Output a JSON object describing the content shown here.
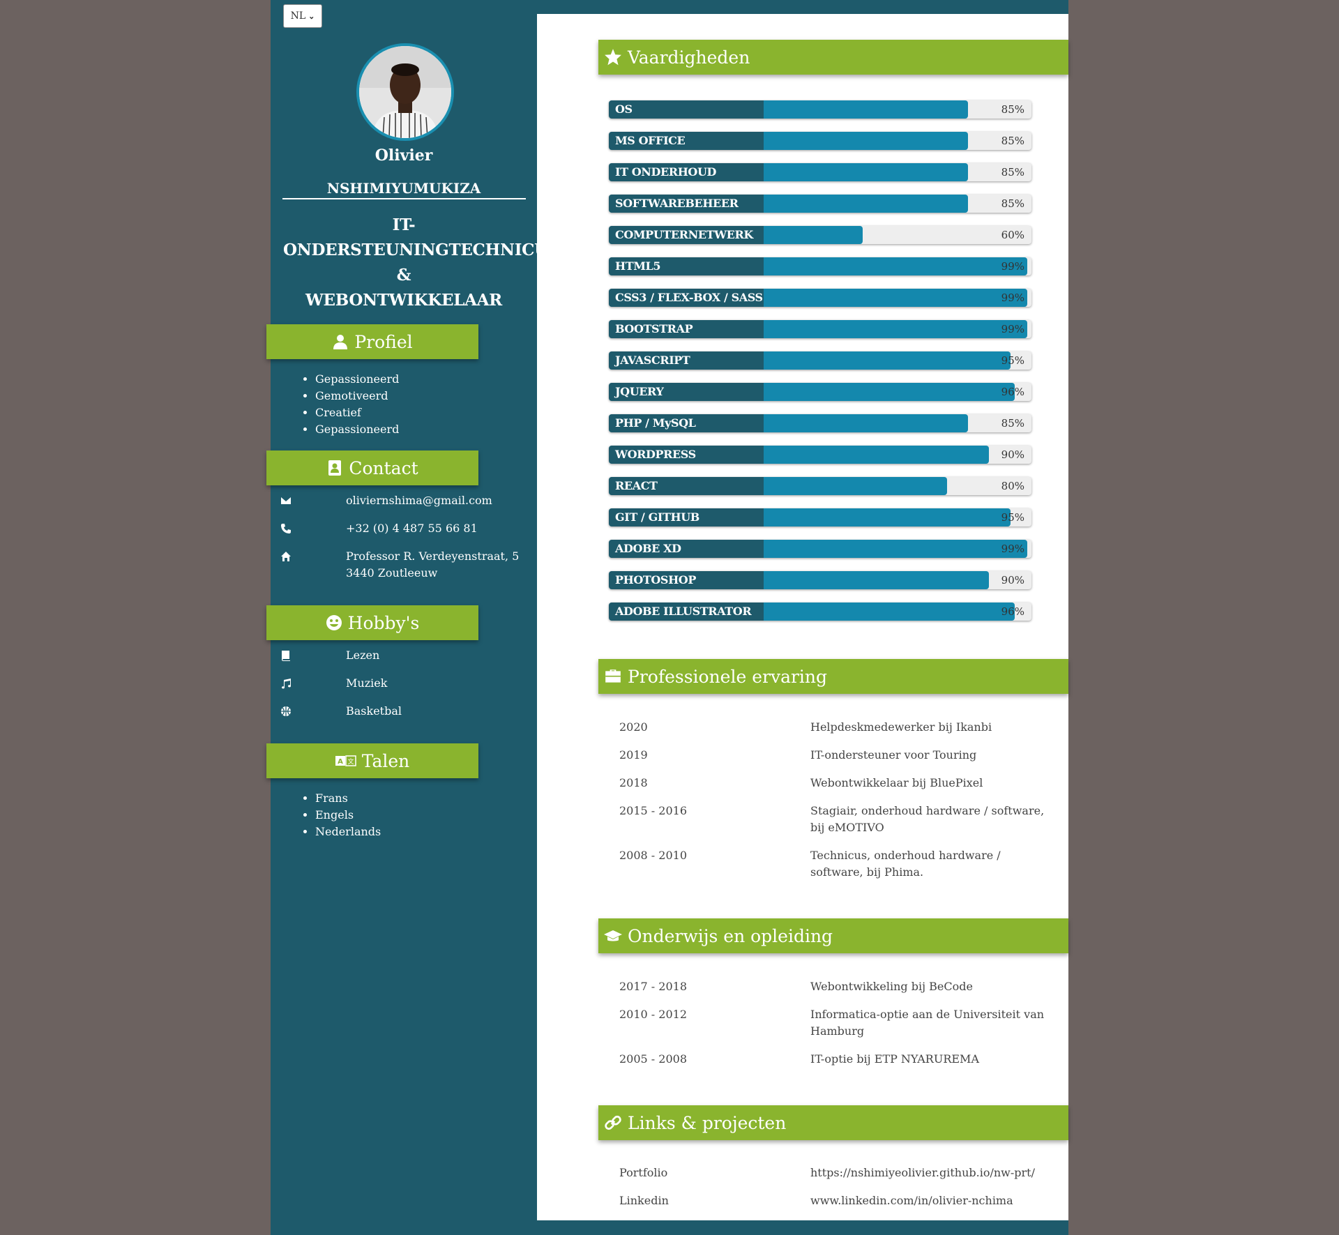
{
  "language": "NL",
  "profile": {
    "first_name": "Olivier",
    "last_name": "NSHIMIYUMUKIZA",
    "title_lines": [
      "IT-",
      "ONDERSTEUNINGTECHNICUS",
      "&",
      "WEBONTWIKKELAAR"
    ]
  },
  "sidebar": {
    "profiel": {
      "heading": "Profiel",
      "items": [
        "Gepassioneerd",
        "Gemotiveerd",
        "Creatief",
        "Gepassioneerd"
      ]
    },
    "contact": {
      "heading": "Contact",
      "email": "oliviernshima@gmail.com",
      "phone": "+32 (0) 4 487 55 66 81",
      "address": "Professor R. Verdeyenstraat, 5 3440 Zoutleeuw"
    },
    "hobbies": {
      "heading": "Hobby's",
      "items": [
        "Lezen",
        "Muziek",
        "Basketbal"
      ]
    },
    "talen": {
      "heading": "Talen",
      "items": [
        "Frans",
        "Engels",
        "Nederlands"
      ]
    }
  },
  "skills": {
    "heading": "Vaardigheden",
    "items": [
      {
        "name": "OS",
        "percent": 85,
        "label": "85%"
      },
      {
        "name": "MS OFFICE",
        "percent": 85,
        "label": "85%"
      },
      {
        "name": "IT ONDERHOUD",
        "percent": 85,
        "label": "85%"
      },
      {
        "name": "SOFTWAREBEHEER",
        "percent": 85,
        "label": "85%"
      },
      {
        "name": "COMPUTERNETWERK",
        "percent": 60,
        "label": "60%"
      },
      {
        "name": "HTML5",
        "percent": 99,
        "label": "99%"
      },
      {
        "name": "CSS3 / FLEX-BOX / SASS",
        "percent": 99,
        "label": "99%"
      },
      {
        "name": "BOOTSTRAP",
        "percent": 99,
        "label": "99%"
      },
      {
        "name": "JAVASCRIPT",
        "percent": 95,
        "label": "95%"
      },
      {
        "name": "JQUERY",
        "percent": 96,
        "label": "96%"
      },
      {
        "name": "PHP / MySQL",
        "percent": 85,
        "label": "85%"
      },
      {
        "name": "WORDPRESS",
        "percent": 90,
        "label": "90%"
      },
      {
        "name": "REACT",
        "percent": 80,
        "label": "80%"
      },
      {
        "name": "GIT / GITHUB",
        "percent": 95,
        "label": "95%"
      },
      {
        "name": "ADOBE XD",
        "percent": 99,
        "label": "99%"
      },
      {
        "name": "PHOTOSHOP",
        "percent": 90,
        "label": "90%"
      },
      {
        "name": "ADOBE ILLUSTRATOR",
        "percent": 96,
        "label": "96%"
      }
    ]
  },
  "experience": {
    "heading": "Professionele ervaring",
    "items": [
      {
        "period": "2020",
        "text": "Helpdeskmedewerker bij Ikanbi"
      },
      {
        "period": "2019",
        "text": "IT-ondersteuner voor Touring"
      },
      {
        "period": "2018",
        "text": "Webontwikkelaar bij BluePixel"
      },
      {
        "period": "2015 - 2016",
        "text": "Stagiair, onderhoud hardware / software, bij eMOTIVO"
      },
      {
        "period": "2008 - 2010",
        "text": "Technicus, onderhoud hardware / software, bij Phima."
      }
    ]
  },
  "education": {
    "heading": "Onderwijs en opleiding",
    "items": [
      {
        "period": "2017 - 2018",
        "text": "Webontwikkeling bij BeCode"
      },
      {
        "period": "2010 - 2012",
        "text": "Informatica-optie aan de Universiteit van Hamburg"
      },
      {
        "period": "2005 - 2008",
        "text": "IT-optie bij ETP NYARUREMA"
      }
    ]
  },
  "links": {
    "heading": "Links & projecten",
    "items": [
      {
        "label": "Portfolio",
        "url": "https://nshimiyeolivier.github.io/nw-prt/"
      },
      {
        "label": "Linkedin",
        "url": "www.linkedin.com/in/olivier-nchima"
      }
    ]
  }
}
